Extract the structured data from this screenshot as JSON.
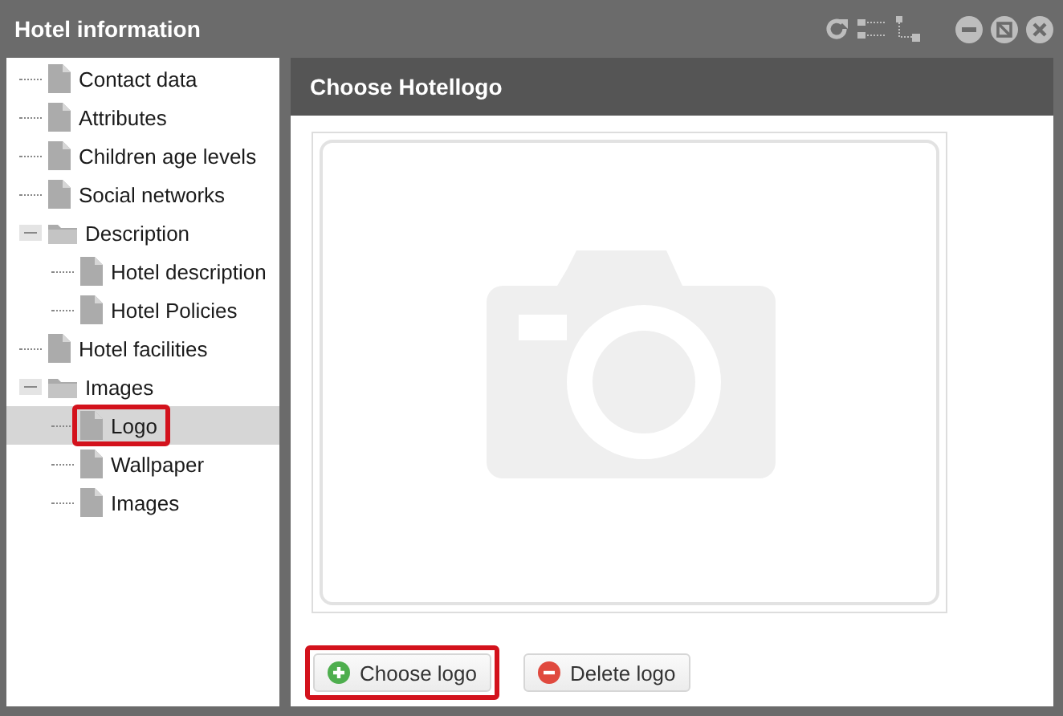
{
  "window": {
    "title": "Hotel information"
  },
  "tree": [
    {
      "label": "Contact data",
      "kind": "file",
      "selected": false,
      "highlighted": false
    },
    {
      "label": "Attributes",
      "kind": "file",
      "selected": false,
      "highlighted": false
    },
    {
      "label": "Children age levels",
      "kind": "file",
      "selected": false,
      "highlighted": false
    },
    {
      "label": "Social networks",
      "kind": "file",
      "selected": false,
      "highlighted": false
    },
    {
      "label": "Description",
      "kind": "folder",
      "selected": false,
      "highlighted": false,
      "expanded": true,
      "children": [
        {
          "label": "Hotel description",
          "kind": "file",
          "selected": false,
          "highlighted": false
        },
        {
          "label": "Hotel Policies",
          "kind": "file",
          "selected": false,
          "highlighted": false
        }
      ]
    },
    {
      "label": "Hotel facilities",
      "kind": "file",
      "selected": false,
      "highlighted": false
    },
    {
      "label": "Images",
      "kind": "folder",
      "selected": false,
      "highlighted": false,
      "expanded": true,
      "children": [
        {
          "label": "Logo",
          "kind": "file",
          "selected": true,
          "highlighted": true
        },
        {
          "label": "Wallpaper",
          "kind": "file",
          "selected": false,
          "highlighted": false
        },
        {
          "label": "Images",
          "kind": "file",
          "selected": false,
          "highlighted": false
        }
      ]
    }
  ],
  "panel": {
    "title": "Choose Hotellogo",
    "image": {
      "kind": "placeholder"
    }
  },
  "buttons": [
    {
      "label": "Choose logo",
      "kind": "add",
      "highlighted": true
    },
    {
      "label": "Delete logo",
      "kind": "delete",
      "highlighted": false
    }
  ]
}
